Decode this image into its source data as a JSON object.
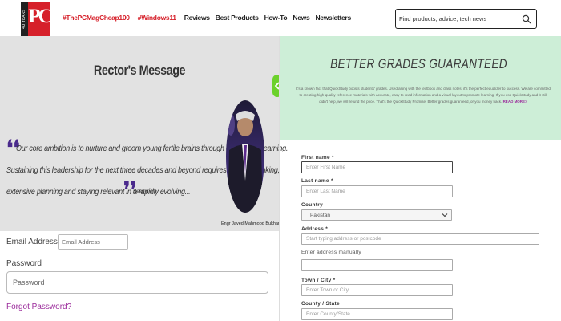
{
  "header": {
    "logo_text": "PC",
    "logo_years": "40 YEARS",
    "nav": [
      {
        "label": "#ThePCMagCheap100",
        "kind": "tag"
      },
      {
        "label": "#Windows11",
        "kind": "tag"
      },
      {
        "label": "Reviews",
        "kind": "item"
      },
      {
        "label": "Best Products",
        "kind": "item"
      },
      {
        "label": "How-To",
        "kind": "item"
      },
      {
        "label": "News",
        "kind": "item"
      },
      {
        "label": "Newsletters",
        "kind": "item"
      }
    ],
    "search_placeholder": "Find products, advice, tech news"
  },
  "rector": {
    "title": "Rector's Message",
    "quote_lines": [
      "Our core ambition is to nurture and groom young fertile brains through experiential learning.",
      "Sustaining this leadership for the next three decades and beyond requires futuristic thinking,",
      "extensive planning and staying relevant in a rapidly evolving..."
    ],
    "read_more": "Read more",
    "name": "Engr Javed Mahmood Bukhari"
  },
  "login": {
    "email_label": "Email Address",
    "email_placeholder": "Email Address",
    "password_label": "Password",
    "password_placeholder": "Password",
    "forgot": "Forgot Password?"
  },
  "promo": {
    "title": "BETTER GRADES GUARANTEED",
    "body": "It's a known fact that QuickStudy boosts students' grades. Used along with the textbook and class notes, it's the perfect equalizer to success. We are committed to creating high-quality reference materials with accurate, easy-to-read information and a visual layout to promote learning. If you use QuickStudy and it still didn't help, we will refund the price. That's the QuickStudy Promise! Better grades guaranteed, or you money back.",
    "read_more": "READ MORE>"
  },
  "address_form": {
    "first_name_label": "First name *",
    "first_name_placeholder": "Enter First Name",
    "last_name_label": "Last name *",
    "last_name_placeholder": "Enter Last Name",
    "country_label": "Country",
    "country_value": "Pakistan",
    "address_label": "Address *",
    "address_placeholder": "Start typing address or postcode",
    "manual_link": "Enter address manually",
    "town_label": "Town / City *",
    "town_placeholder": "Enter Town or City",
    "county_label": "County / State",
    "county_placeholder": "Enter County/State"
  },
  "colors": {
    "brand_red": "#d6202a",
    "left_panel_bg": "#e2e2e2",
    "right_panel_bg": "#cdeed7",
    "link_purple": "#9b2b9b",
    "toggle_green": "#6cd12b"
  }
}
